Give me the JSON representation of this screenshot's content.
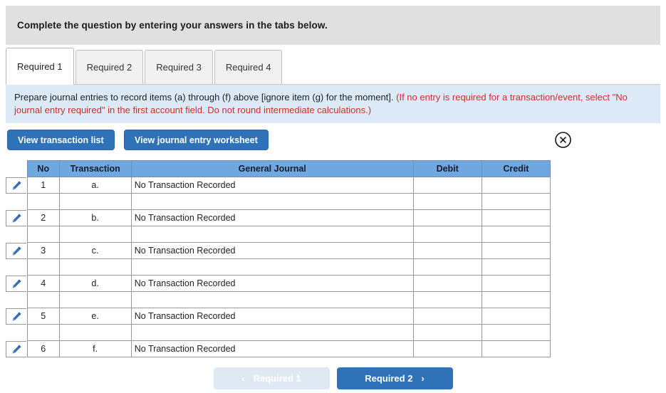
{
  "banner": {
    "text": "Complete the question by entering your answers in the tabs below."
  },
  "tabs": [
    {
      "label": "Required 1",
      "active": true
    },
    {
      "label": "Required 2",
      "active": false
    },
    {
      "label": "Required 3",
      "active": false
    },
    {
      "label": "Required 4",
      "active": false
    }
  ],
  "info_panel": {
    "main_text": "Prepare journal entries to record items (a) through (f) above [ignore item (g) for the moment].",
    "red_text": "(If no entry is required for a transaction/event, select \"No journal entry required\" in the first account field. Do not round intermediate calculations.)"
  },
  "actions": {
    "view_transaction_list": "View transaction list",
    "view_journal_entry_worksheet": "View journal entry worksheet",
    "close_icon": "close-circle-icon"
  },
  "table": {
    "headers": [
      "No",
      "Transaction",
      "General Journal",
      "Debit",
      "Credit"
    ],
    "rows": [
      {
        "no": "1",
        "transaction": "a.",
        "general_journal": "No Transaction Recorded",
        "debit": "",
        "credit": ""
      },
      {
        "no": "2",
        "transaction": "b.",
        "general_journal": "No Transaction Recorded",
        "debit": "",
        "credit": ""
      },
      {
        "no": "3",
        "transaction": "c.",
        "general_journal": "No Transaction Recorded",
        "debit": "",
        "credit": ""
      },
      {
        "no": "4",
        "transaction": "d.",
        "general_journal": "No Transaction Recorded",
        "debit": "",
        "credit": ""
      },
      {
        "no": "5",
        "transaction": "e.",
        "general_journal": "No Transaction Recorded",
        "debit": "",
        "credit": ""
      },
      {
        "no": "6",
        "transaction": "f.",
        "general_journal": "No Transaction Recorded",
        "debit": "",
        "credit": ""
      }
    ],
    "row_edit_icon": "pencil-icon"
  },
  "bottom_nav": {
    "prev_label": "Required 1",
    "prev_chevron": "‹",
    "prev_disabled": true,
    "next_label": "Required 2",
    "next_chevron": "›"
  },
  "colors": {
    "banner_gray": "#e0e0e0",
    "info_blue": "#dceaf7",
    "red_text": "#c8302b",
    "button_blue": "#2f72b8",
    "table_header_blue": "#6fa8e0",
    "disabled_button": "#dfe9f3"
  }
}
